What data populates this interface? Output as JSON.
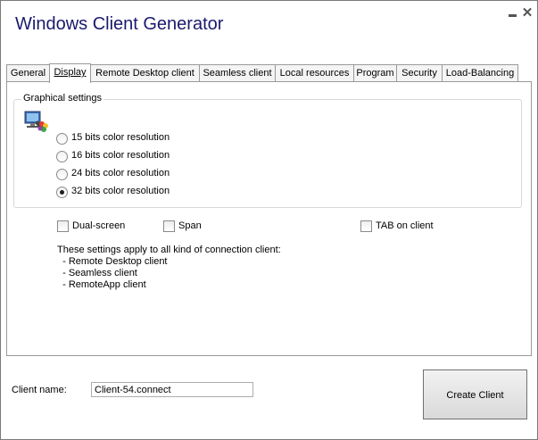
{
  "window": {
    "title": "Windows Client Generator"
  },
  "tabs": [
    {
      "label": "General",
      "active": false
    },
    {
      "label": "Display",
      "active": true
    },
    {
      "label": "Remote Desktop client",
      "active": false
    },
    {
      "label": "Seamless client",
      "active": false
    },
    {
      "label": "Local resources",
      "active": false
    },
    {
      "label": "Program",
      "active": false
    },
    {
      "label": "Security",
      "active": false
    },
    {
      "label": "Load-Balancing",
      "active": false
    }
  ],
  "graphical": {
    "group_title": "Graphical settings",
    "icon": "monitor-color-icon",
    "options": [
      {
        "label": "15 bits color resolution",
        "checked": false
      },
      {
        "label": "16 bits color resolution",
        "checked": false
      },
      {
        "label": "24 bits color resolution",
        "checked": false
      },
      {
        "label": "32 bits color resolution",
        "checked": true
      }
    ]
  },
  "checkboxes": [
    {
      "label": "Dual-screen",
      "checked": false
    },
    {
      "label": "Span",
      "checked": false
    },
    {
      "label": "TAB on client",
      "checked": false
    }
  ],
  "info": {
    "line1": "These settings apply to all kind of connection client:",
    "line2": "  - Remote Desktop client",
    "line3": "  - Seamless client",
    "line4": "  - RemoteApp client"
  },
  "client_name": {
    "label": "Client name:",
    "value": "Client-54.connect"
  },
  "create_button": {
    "label": "Create Client"
  },
  "colors": {
    "title": "#1a1a6e",
    "border": "#9a9a9a"
  }
}
